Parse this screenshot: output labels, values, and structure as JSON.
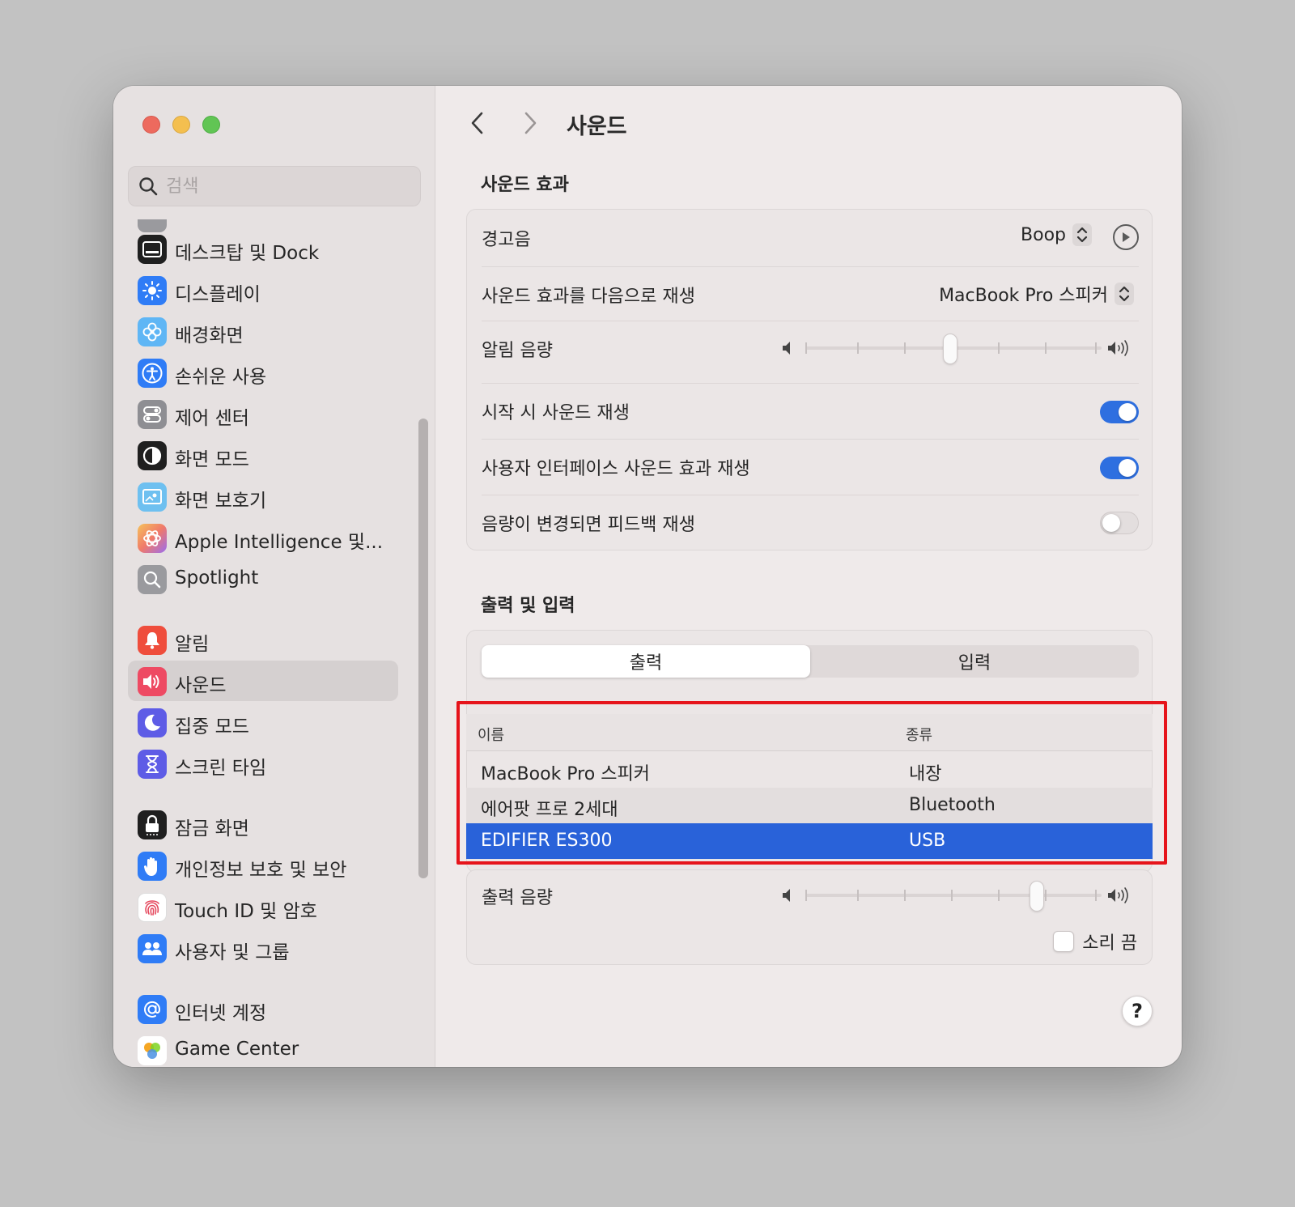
{
  "window": {
    "title": "사운드"
  },
  "sidebar": {
    "search_placeholder": "검색",
    "items": [
      {
        "label": "데스크탑 및 Dock",
        "icon": "dock-icon",
        "color": "#1f1f1f"
      },
      {
        "label": "디스플레이",
        "icon": "display-brightness-icon",
        "color": "#2f7cf6"
      },
      {
        "label": "배경화면",
        "icon": "wallpaper-flower-icon",
        "color": "#5fb6f5"
      },
      {
        "label": "손쉬운 사용",
        "icon": "accessibility-icon",
        "color": "#2f7cf6"
      },
      {
        "label": "제어 센터",
        "icon": "control-center-icon",
        "color": "#8e8e93"
      },
      {
        "label": "화면 모드",
        "icon": "appearance-icon",
        "color": "#1f1f1f"
      },
      {
        "label": "화면 보호기",
        "icon": "screensaver-icon",
        "color": "#6ec0f0"
      },
      {
        "label": "Apple Intelligence 및...",
        "icon": "apple-intelligence-icon",
        "color": "#f0a060"
      },
      {
        "label": "Spotlight",
        "icon": "spotlight-search-icon",
        "color": "#9a9a9e"
      },
      {
        "label": "알림",
        "icon": "notifications-bell-icon",
        "color": "#ef4d3c"
      },
      {
        "label": "사운드",
        "icon": "sound-speaker-icon",
        "color": "#ee4a63",
        "active": true
      },
      {
        "label": "집중 모드",
        "icon": "focus-moon-icon",
        "color": "#5e5ce6"
      },
      {
        "label": "스크린 타임",
        "icon": "screen-time-hourglass-icon",
        "color": "#5e5ce6"
      },
      {
        "label": "잠금 화면",
        "icon": "lock-screen-icon",
        "color": "#1f1f1f"
      },
      {
        "label": "개인정보 보호 및 보안",
        "icon": "privacy-hand-icon",
        "color": "#2f7cf6"
      },
      {
        "label": "Touch ID 및 암호",
        "icon": "fingerprint-icon",
        "color": "#ffffff"
      },
      {
        "label": "사용자 및 그룹",
        "icon": "users-groups-icon",
        "color": "#2f7cf6"
      },
      {
        "label": "인터넷 계정",
        "icon": "internet-accounts-at-icon",
        "color": "#2f7cf6"
      },
      {
        "label": "Game Center",
        "icon": "game-center-icon",
        "color": "#ffffff"
      }
    ]
  },
  "sound_effects": {
    "section_title": "사운드 효과",
    "alert_sound": {
      "label": "경고음",
      "value": "Boop"
    },
    "play_through": {
      "label": "사운드 효과를 다음으로 재생",
      "value": "MacBook Pro 스피커"
    },
    "alert_volume": {
      "label": "알림 음량",
      "level": 0.5
    },
    "startup_sound": {
      "label": "시작 시 사운드 재생",
      "on": true
    },
    "ui_sound": {
      "label": "사용자 인터페이스 사운드 효과 재생",
      "on": true
    },
    "feedback_sound": {
      "label": "음량이 변경되면 피드백 재생",
      "on": false
    }
  },
  "output_input": {
    "section_title": "출력 및 입력",
    "tabs": {
      "output": "출력",
      "input": "입력",
      "selected": "output"
    },
    "table": {
      "col_name": "이름",
      "col_type": "종류",
      "rows": [
        {
          "name": "MacBook Pro 스피커",
          "type": "내장"
        },
        {
          "name": "에어팟 프로 2세대",
          "type": "Bluetooth"
        },
        {
          "name": "EDIFIER ES300",
          "type": "USB",
          "selected": true
        }
      ]
    },
    "output_volume": {
      "label": "출력 음량",
      "level": 0.8
    },
    "mute": {
      "label": "소리 끔",
      "checked": false
    }
  },
  "help": {
    "label": "?"
  },
  "colors": {
    "accent": "#2962d9",
    "highlight_box": "#e6141b"
  }
}
